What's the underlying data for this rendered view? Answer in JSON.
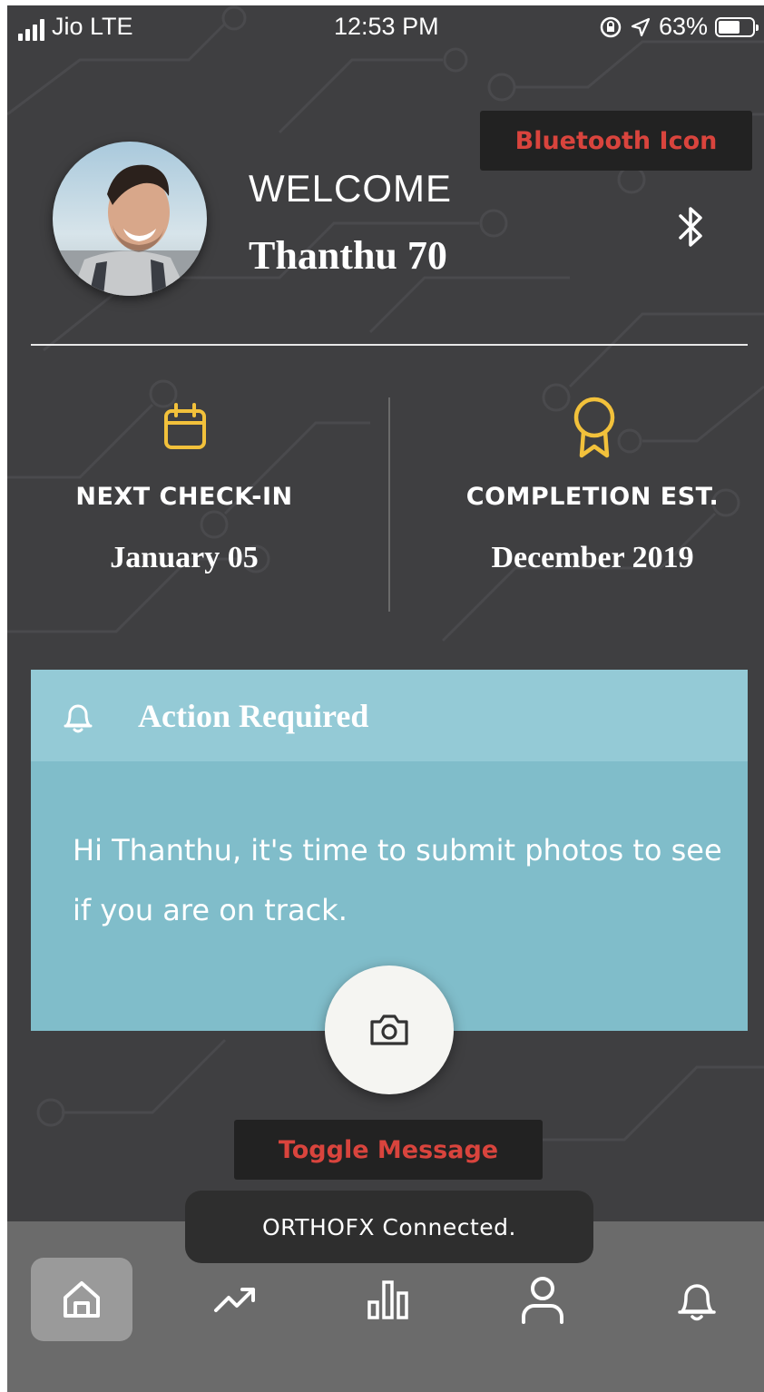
{
  "status_bar": {
    "carrier": "Jio LTE",
    "time": "12:53 PM",
    "battery": "63%",
    "battery_level": 0.63
  },
  "overlay_buttons": {
    "bluetooth_label": "Bluetooth Icon",
    "toggle_label": "Toggle Message"
  },
  "profile": {
    "greeting": "WELCOME",
    "name": "Thanthu 70"
  },
  "stats": {
    "next_checkin": {
      "title": "NEXT CHECK-IN",
      "value": "January 05",
      "icon": "calendar-icon"
    },
    "completion": {
      "title": "COMPLETION EST.",
      "value": "December 2019",
      "icon": "award-ribbon-icon"
    }
  },
  "action_card": {
    "title": "Action Required",
    "message": "Hi Thanthu, it's time to submit photos to see if you are on track."
  },
  "toast": {
    "message": "ORTHOFX Connected."
  },
  "nav": {
    "items": [
      "home-icon",
      "trending-up-icon",
      "bar-chart-icon",
      "profile-icon",
      "notifications-bell-icon"
    ],
    "active": "home-icon"
  },
  "colors": {
    "background": "#3f3f41",
    "accent_yellow": "#f2c13b",
    "card": "#80bdca",
    "card_header": "#94cad6",
    "alert_red": "#d9443d",
    "nav": "#6b6b6b"
  }
}
